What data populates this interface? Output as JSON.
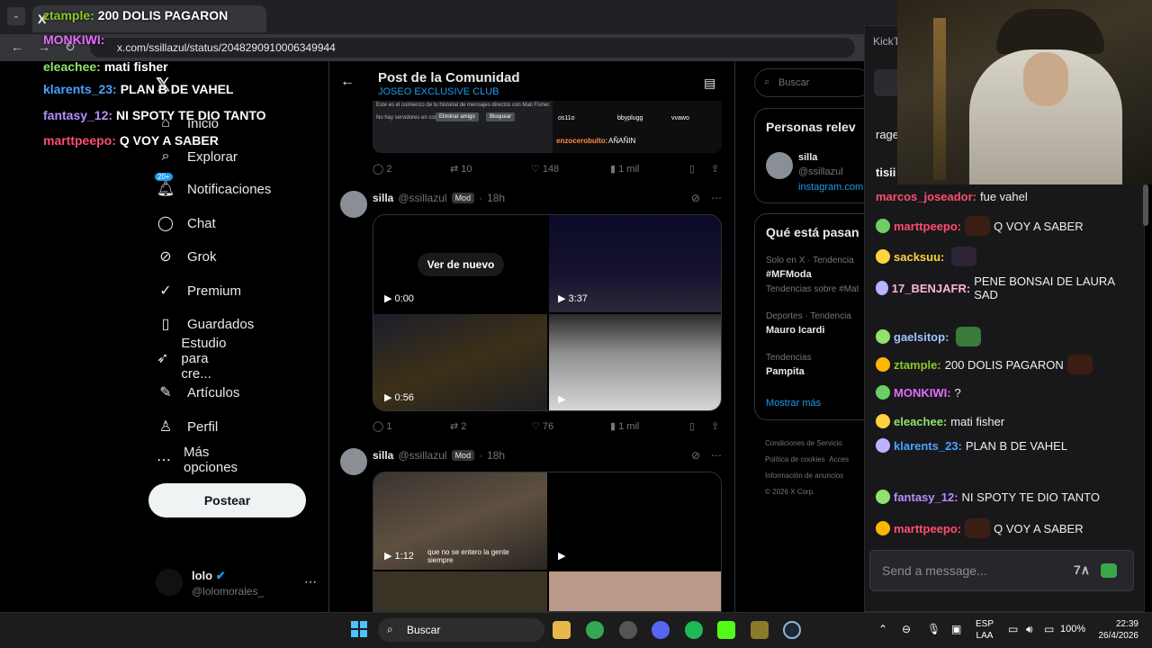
{
  "browser": {
    "tab_prefix": "X",
    "url": "x.com/ssillazul/status/2048290910006349944"
  },
  "overlay_chat": [
    {
      "user": "ztample:",
      "msg": "200 DOLIS PAGARON",
      "color": "#8ac926"
    },
    {
      "user": "MONKIWI:",
      "msg": "",
      "color": "#e56bff"
    },
    {
      "user": "eleachee:",
      "msg": "mati fisher",
      "color": "#8fe36c"
    },
    {
      "user": "klarents_23:",
      "msg": "PLAN B DE VAHEL",
      "color": "#4aa3ff"
    },
    {
      "user": "fantasy_12:",
      "msg": "NI SPOTY TE DIO TANTO",
      "color": "#b98bff"
    },
    {
      "user": "marttpeepo:",
      "msg": "Q VOY A SABER",
      "color": "#ff4d6d"
    }
  ],
  "left_nav": {
    "items": [
      {
        "label": "Inicio",
        "icon": "home-icon"
      },
      {
        "label": "Explorar",
        "icon": "search-icon"
      },
      {
        "label": "Notificaciones",
        "icon": "bell-icon",
        "badge": "20+"
      },
      {
        "label": "Chat",
        "icon": "chat-icon"
      },
      {
        "label": "Grok",
        "icon": "grok-icon"
      },
      {
        "label": "Premium",
        "icon": "premium-icon"
      },
      {
        "label": "Guardados",
        "icon": "bookmark-icon"
      },
      {
        "label": "Estudio para cre...",
        "icon": "rocket-icon"
      },
      {
        "label": "Artículos",
        "icon": "article-icon"
      },
      {
        "label": "Perfil",
        "icon": "person-icon"
      },
      {
        "label": "Más opciones",
        "icon": "more-icon"
      }
    ],
    "post_button": "Postear",
    "account": {
      "name": "lolo",
      "handle": "@lolomorales_"
    }
  },
  "feed": {
    "header_title": "Post de la Comunidad",
    "header_subtitle": "JOSEO EXCLUSIVE CLUB",
    "first_post": {
      "dm_text": "Este es el comienzo de tu historial de mensajes directos con Mati Fisher.",
      "no_servers": "No hay servidores en común",
      "remove_friend": "Eliminar amigo",
      "block": "Bloquear",
      "user1": "os11o",
      "user2": "bbyplugg",
      "user3": "vvawo",
      "chat_user": "enzocerobulto:",
      "chat_msg": "AÑAÑIN",
      "replies": "2",
      "retweets": "10",
      "likes": "148",
      "views": "1 mil"
    },
    "tweets": [
      {
        "name": "silla",
        "handle": "@ssillazul",
        "badge": "Mod",
        "time": "18h",
        "rewatch": "Ver de nuevo",
        "video_times": [
          "0:00",
          "3:37",
          "0:56"
        ],
        "replies": "1",
        "retweets": "2",
        "likes": "76",
        "views": "1 mil"
      },
      {
        "name": "silla",
        "handle": "@ssillazul",
        "badge": "Mod",
        "time": "18h",
        "video_times": [
          "1:12"
        ],
        "caption": "que no se entero la gente siempre"
      }
    ]
  },
  "right": {
    "search_placeholder": "Buscar",
    "people_title": "Personas relev",
    "person_name": "silla",
    "person_handle": "@ssillazul",
    "person_link": "instagram.com",
    "trends_title": "Qué está pasan",
    "trends": [
      {
        "meta": "Solo en X · Tendencia",
        "name": "#MFModa",
        "extra": "Tendencias sobre #Mat"
      },
      {
        "meta": "Deportes · Tendencia",
        "name": "Mauro Icardi",
        "extra": ""
      },
      {
        "meta": "Tendencias",
        "name": "Pampita",
        "extra": ""
      }
    ],
    "show_more": "Mostrar más",
    "footer": [
      "Condiciones de Servicio",
      "Política de cookies",
      "Acces",
      "Información de anuncios",
      "© 2026 X Corp."
    ]
  },
  "chat": {
    "title": "KickT",
    "rage_text": "rage",
    "tisi_text": "tisii",
    "messages": [
      {
        "user": "marcos_joseador:",
        "msg": "fue vahel",
        "color": "#ff4d6d"
      },
      {
        "user": "marttpeepo:",
        "msg": "Q VOY A SABER",
        "color": "#ff4d6d"
      },
      {
        "user": "sacksuu:",
        "msg": "",
        "color": "#ffd23f"
      },
      {
        "user": "17_BENJAFR:",
        "msg": "PENE BONSAI DE LAURA SAD",
        "color": "#ffb3d9"
      },
      {
        "user": "gaelsitop:",
        "msg": "",
        "color": "#a3c4ff"
      },
      {
        "user": "ztample:",
        "msg": "200 DOLIS PAGARON",
        "color": "#8ac926"
      },
      {
        "user": "MONKIWI:",
        "msg": "?",
        "color": "#e56bff"
      },
      {
        "user": "eleachee:",
        "msg": "mati fisher",
        "color": "#8fe36c"
      },
      {
        "user": "klarents_23:",
        "msg": "PLAN B DE VAHEL",
        "color": "#4aa3ff"
      },
      {
        "user": "fantasy_12:",
        "msg": "NI SPOTY TE DIO TANTO",
        "color": "#b98bff"
      },
      {
        "user": "marttpeepo:",
        "msg": "Q VOY A SABER",
        "color": "#ff4d6d"
      }
    ],
    "input_placeholder": "Send a message..."
  },
  "taskbar": {
    "search_label": "Buscar",
    "lang": "ESP",
    "region": "LAA",
    "battery": "100%",
    "time": "22:39",
    "date": "26/4/2026"
  }
}
